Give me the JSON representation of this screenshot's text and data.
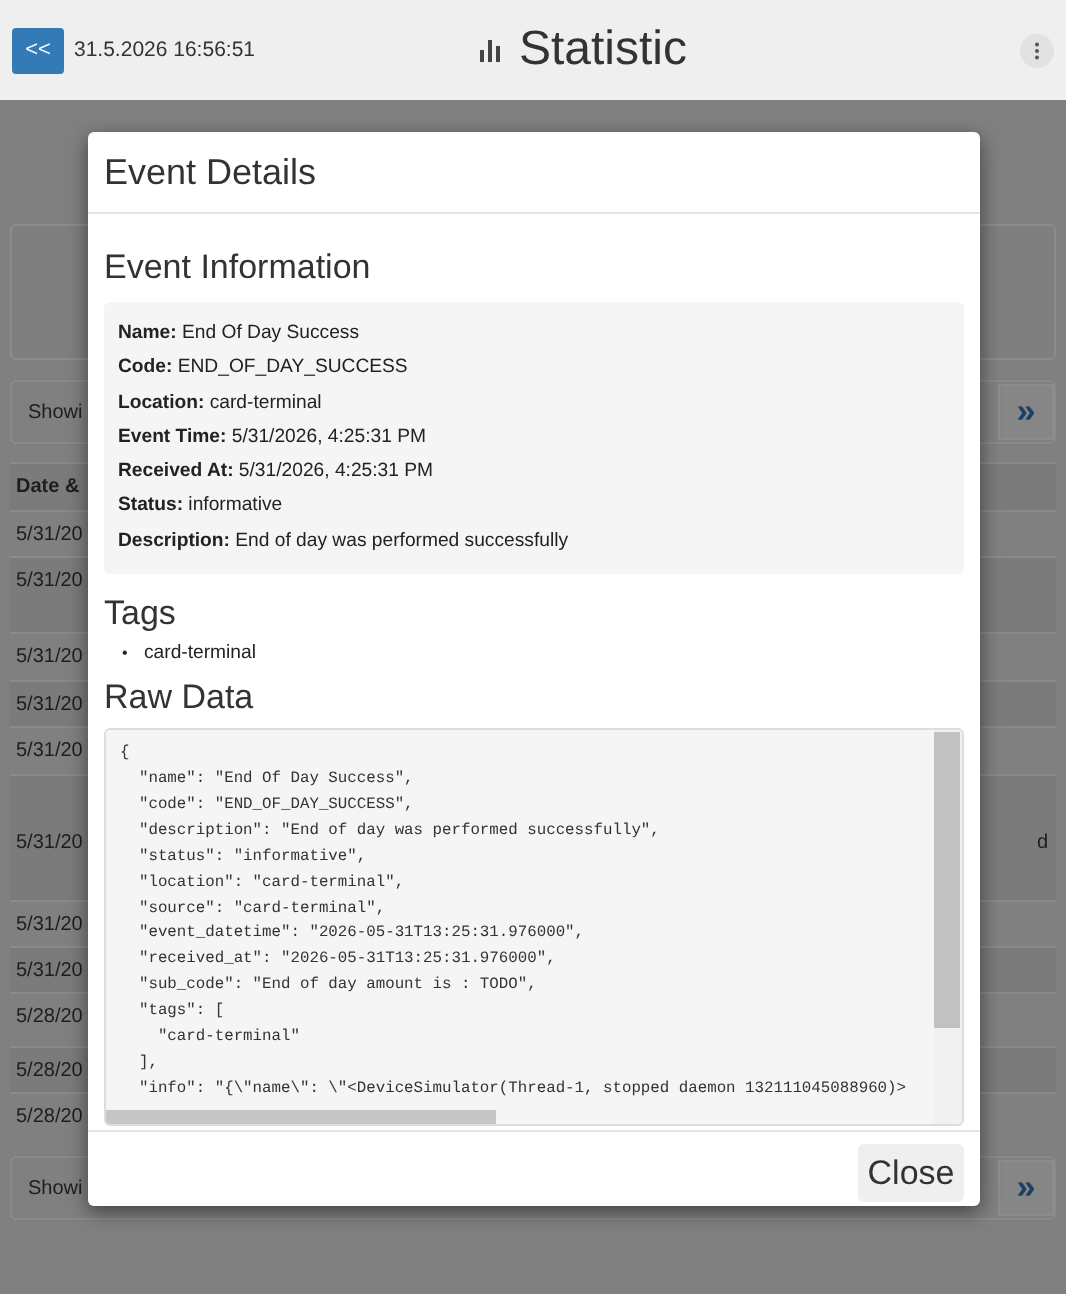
{
  "header": {
    "back_button": "<<",
    "datetime": "31.5.2026 16:56:51",
    "title": "Statistic"
  },
  "background": {
    "pager_top": {
      "text": "Showi",
      "next": "»"
    },
    "table": {
      "column_1": "Date &",
      "rows": [
        {
          "cell": "5/31/20"
        },
        {
          "cell": "5/31/20"
        },
        {
          "cell": "5/31/20"
        },
        {
          "cell": "5/31/20"
        },
        {
          "cell": "5/31/20"
        },
        {
          "cell": "5/31/20",
          "cell_last": "d"
        },
        {
          "cell": "5/31/20"
        },
        {
          "cell": "5/31/20"
        },
        {
          "cell": "5/28/20"
        },
        {
          "cell": "5/28/20"
        },
        {
          "cell": "5/28/20"
        }
      ]
    },
    "pager_bottom": {
      "text": "Showi",
      "next": "»"
    }
  },
  "modal": {
    "title": "Event Details",
    "info_heading": "Event Information",
    "fields": [
      "**Name:** End Of Day Success",
      "**Code:** END_OF_DAY_SUCCESS",
      "**Location:** card-terminal",
      "**Event Time:** 5/31/2026, 4:25:31 PM",
      "**Received At:** 5/31/2026, 4:25:31 PM",
      "**Status:** informative",
      "**Description:** End of day was performed successfully"
    ],
    "tags_heading": "Tags",
    "tags": [
      {
        "bullet": "•",
        "text": "card-terminal"
      }
    ],
    "raw_heading": "Raw Data",
    "raw_lines": [
      "{",
      "  \"name\": \"End Of Day Success\",",
      "  \"code\": \"END_OF_DAY_SUCCESS\",",
      "  \"description\": \"End of day was performed successfully\",",
      "  \"status\": \"informative\",",
      "  \"location\": \"card-terminal\",",
      "  \"source\": \"card-terminal\",",
      "  \"event_datetime\": \"2026-05-31T13:25:31.976000\",",
      "  \"received_at\": \"2026-05-31T13:25:31.976000\",",
      "  \"sub_code\": \"End of day amount is : TODO\",",
      "  \"tags\": [",
      "    \"card-terminal\"",
      "  ],",
      "  \"info\": \"{\\\"name\\\": \\\"<DeviceSimulator(Thread-1, stopped daemon 132111045088960)>"
    ],
    "close_button": "Close"
  }
}
